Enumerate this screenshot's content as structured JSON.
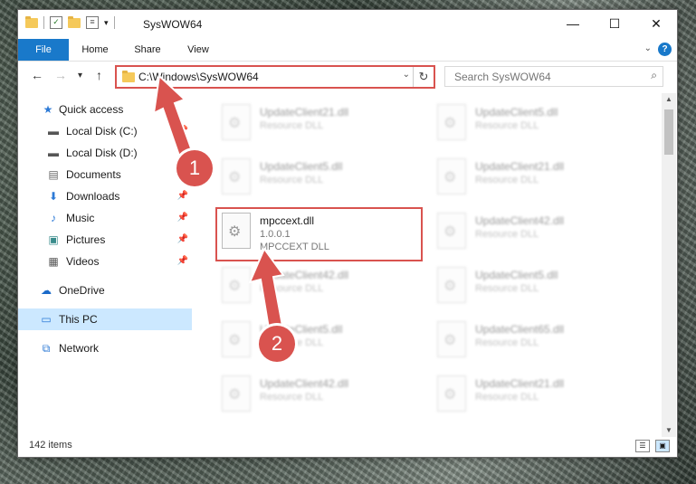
{
  "window": {
    "title": "SysWOW64",
    "minimize": "—",
    "maximize": "☐",
    "close": "✕"
  },
  "ribbon": {
    "tabs": [
      "File",
      "Home",
      "Share",
      "View"
    ],
    "help": "?"
  },
  "nav": {
    "back": "←",
    "forward": "→",
    "recent": "▾",
    "up": "↑",
    "address": "C:\\Windows\\SysWOW64",
    "search_placeholder": "Search SysWOW64"
  },
  "sidebar": {
    "items": [
      {
        "label": "Quick access",
        "icon": "star-icon"
      },
      {
        "label": "Local Disk (C:)",
        "icon": "drive-icon"
      },
      {
        "label": "Local Disk (D:)",
        "icon": "drive-icon"
      },
      {
        "label": "Documents",
        "icon": "documents-icon"
      },
      {
        "label": "Downloads",
        "icon": "download-icon"
      },
      {
        "label": "Music",
        "icon": "music-icon"
      },
      {
        "label": "Pictures",
        "icon": "pictures-icon"
      },
      {
        "label": "Videos",
        "icon": "videos-icon"
      },
      {
        "label": "OneDrive",
        "icon": "cloud-icon"
      },
      {
        "label": "This PC",
        "icon": "pc-icon"
      },
      {
        "label": "Network",
        "icon": "network-icon"
      }
    ]
  },
  "files": [
    {
      "name": "UpdateClient21.dll",
      "desc": "Resource DLL"
    },
    {
      "name": "UpdateClient5.dll",
      "desc": "Resource DLL"
    },
    {
      "name": "UpdateClient5.dll",
      "desc": "Resource DLL"
    },
    {
      "name": "UpdateClient21.dll",
      "desc": "Resource DLL"
    },
    {
      "name": "mpccext.dll",
      "version": "1.0.0.1",
      "desc": "MPCCEXT DLL"
    },
    {
      "name": "UpdateClient42.dll",
      "desc": "Resource DLL"
    },
    {
      "name": "UpdateClient42.dll",
      "desc": "Resource DLL"
    },
    {
      "name": "UpdateClient5.dll",
      "desc": "Resource DLL"
    },
    {
      "name": "UpdateClient5.dll",
      "desc": "Resource DLL"
    },
    {
      "name": "UpdateClient65.dll",
      "desc": "Resource DLL"
    },
    {
      "name": "UpdateClient42.dll",
      "desc": "Resource DLL"
    },
    {
      "name": "UpdateClient21.dll",
      "desc": "Resource DLL"
    }
  ],
  "status": {
    "count": "142 items"
  },
  "annotations": {
    "step1": "1",
    "step2": "2",
    "color": "#d9534f"
  }
}
